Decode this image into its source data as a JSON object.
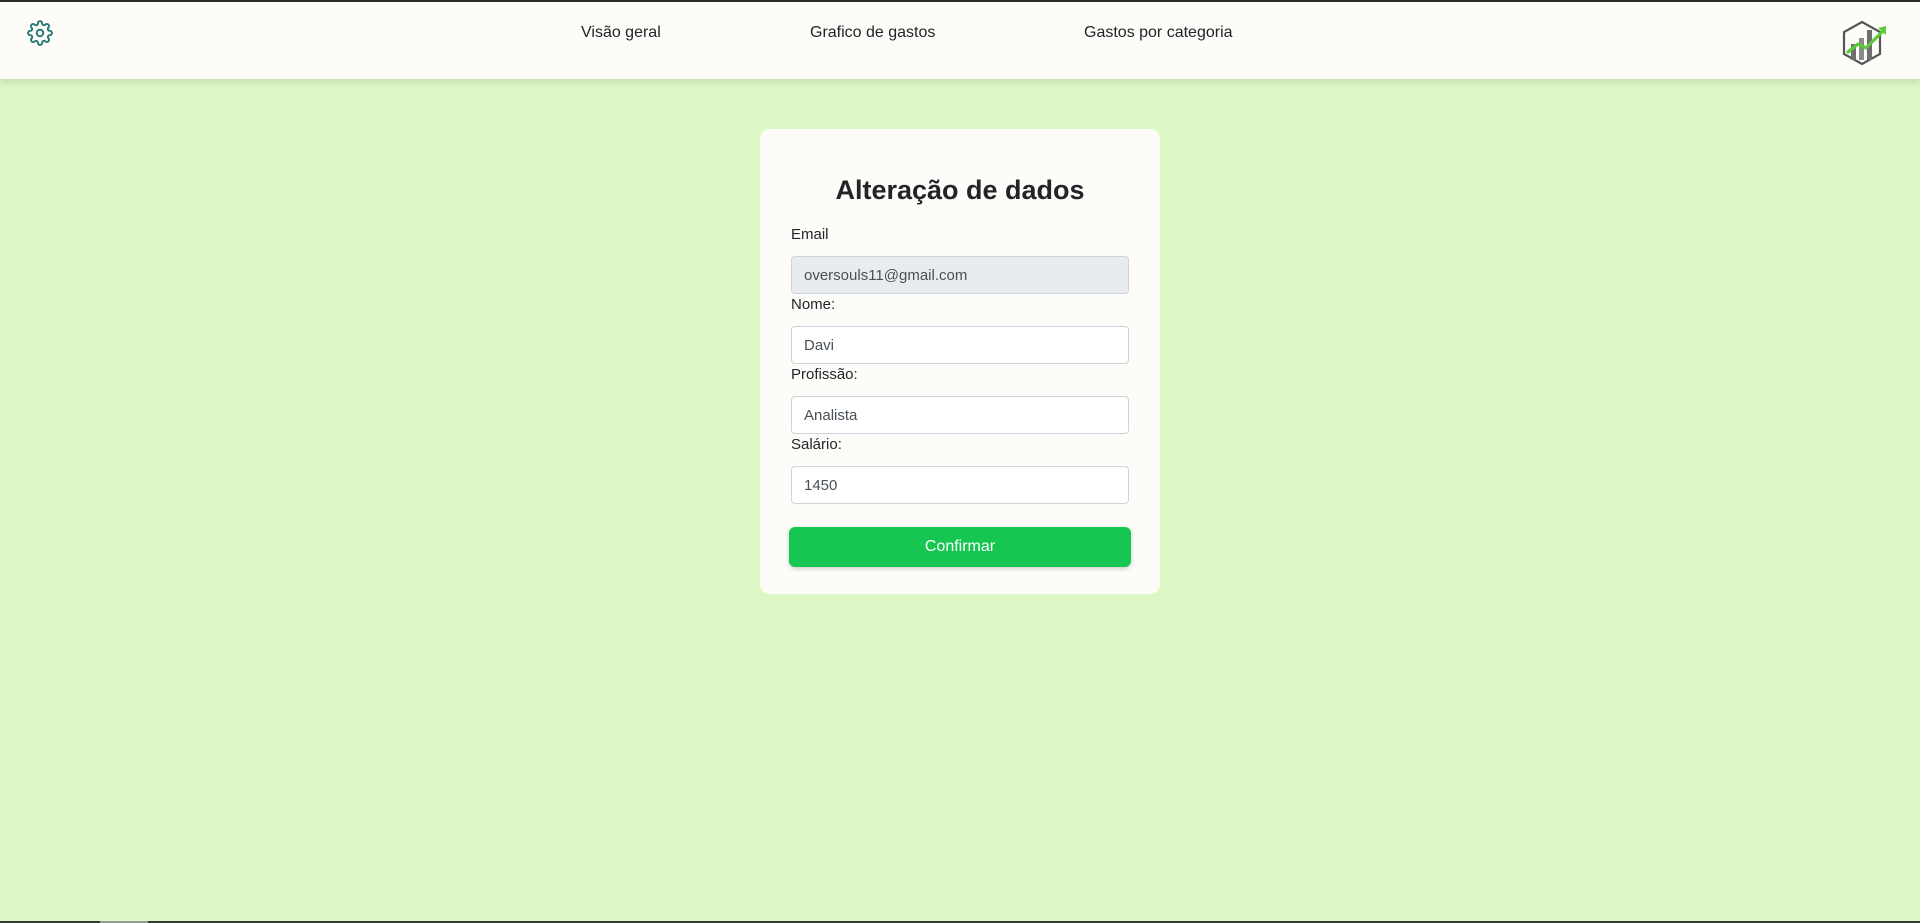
{
  "navbar": {
    "settings_icon": "gear-icon",
    "links": [
      {
        "label": "Visão geral"
      },
      {
        "label": "Grafico de gastos"
      },
      {
        "label": "Gastos por categoria"
      }
    ],
    "logo_icon": "growth-chart-logo"
  },
  "form": {
    "title": "Alteração de dados",
    "email": {
      "label": "Email",
      "value": "oversouls11@gmail.com"
    },
    "name": {
      "label": "Nome:",
      "value": "Davi"
    },
    "profession": {
      "label": "Profissão:",
      "value": "Analista"
    },
    "salary": {
      "label": "Salário:",
      "value": "1450"
    },
    "confirm_label": "Confirmar"
  },
  "colors": {
    "page_background": "#ddf8c5",
    "navbar_background": "#fdfcf8",
    "card_background": "#fdfcf8",
    "button_green": "#16c651",
    "icon_teal": "#2b7a78",
    "logo_green": "#5cc93a"
  }
}
